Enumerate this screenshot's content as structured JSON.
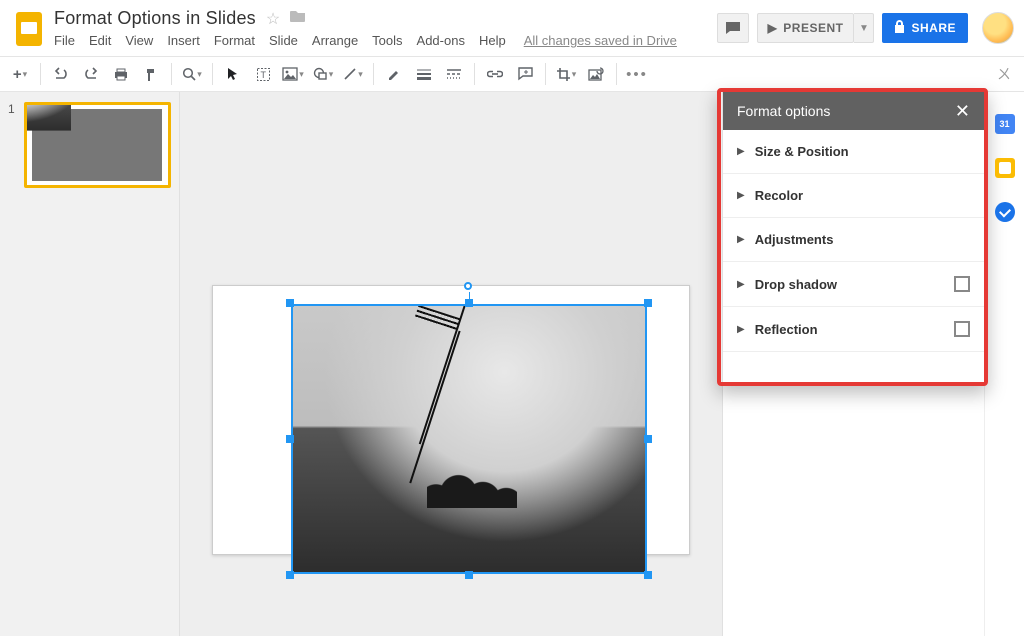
{
  "header": {
    "doc_title": "Format Options in Slides",
    "menus": [
      "File",
      "Edit",
      "View",
      "Insert",
      "Format",
      "Slide",
      "Arrange",
      "Tools",
      "Add-ons",
      "Help"
    ],
    "save_status": "All changes saved in Drive",
    "present_label": "PRESENT",
    "share_label": "SHARE"
  },
  "filmstrip": {
    "slides": [
      {
        "number": "1"
      }
    ]
  },
  "format_options": {
    "title": "Format options",
    "sections": [
      {
        "label": "Size & Position",
        "has_checkbox": false
      },
      {
        "label": "Recolor",
        "has_checkbox": false
      },
      {
        "label": "Adjustments",
        "has_checkbox": false
      },
      {
        "label": "Drop shadow",
        "has_checkbox": true
      },
      {
        "label": "Reflection",
        "has_checkbox": true
      }
    ]
  },
  "right_rail": {
    "calendar_day": "31"
  }
}
